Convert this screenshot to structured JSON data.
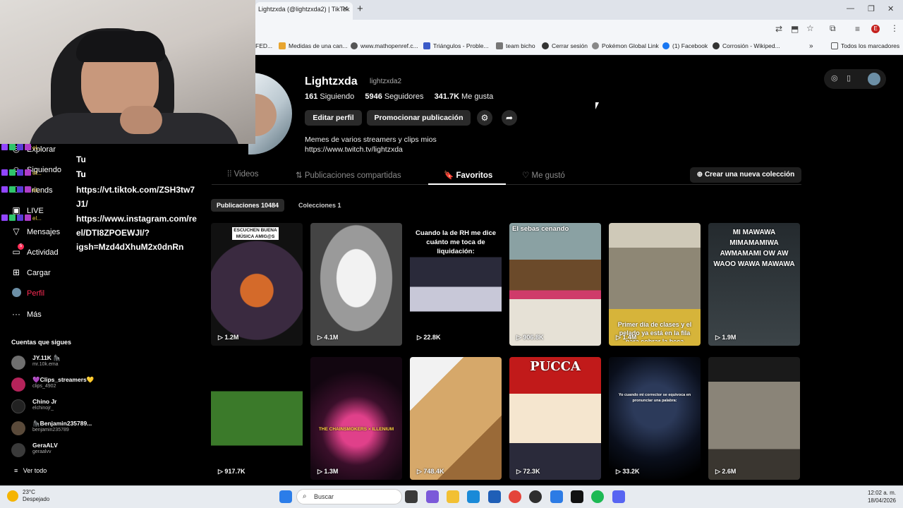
{
  "browser": {
    "tab_title": "Lightzxda (@lightzxda2) | TikTok",
    "new_tab": "+",
    "bookmarks": [
      "FED...",
      "Medidas de una can...",
      "www.mathopenref.c...",
      "Triángulos - Proble...",
      "team bicho",
      "Cerrar sesión",
      "Pokémon Global Link",
      "(1) Facebook",
      "Corrosión - Wikiped..."
    ],
    "all_bookmarks": "Todos los marcadores",
    "profile_initial": "E"
  },
  "sidebar": {
    "items": [
      {
        "label": "Explorar",
        "icon": "compass-icon"
      },
      {
        "label": "Siguiendo",
        "icon": "following-icon"
      },
      {
        "label": "Friends",
        "icon": "friends-icon"
      },
      {
        "label": "LIVE",
        "icon": "live-icon"
      },
      {
        "label": "Mensajes",
        "icon": "send-icon"
      },
      {
        "label": "Actividad",
        "icon": "bell-icon"
      },
      {
        "label": "Cargar",
        "icon": "plus-square-icon"
      },
      {
        "label": "Perfil",
        "icon": "profile-icon"
      },
      {
        "label": "Más",
        "icon": "more-icon"
      }
    ],
    "activity_badge": "5",
    "following_heading": "Cuentas que sigues",
    "accounts": [
      {
        "name": "JY.11K 🦍",
        "handle": "mr.10k.ema",
        "color": "#6f6f6f"
      },
      {
        "name": "💜Clips_streamers💛",
        "handle": "clips_4902",
        "color": "#b4235a"
      },
      {
        "name": "Chino Jr",
        "handle": "elchinojr_",
        "color": "#222222"
      },
      {
        "name": "🦍Benjamin235789...",
        "handle": "benjamin235789",
        "color": "#5a4a3a"
      },
      {
        "name": "GeraALV",
        "handle": "geraalvv",
        "color": "#3a3a3a"
      }
    ],
    "see_all": "Ver todo"
  },
  "chat": {
    "badge_user": "el...",
    "lines": [
      "Tu",
      "Tu",
      "Tu",
      "https://vt.tiktok.com/ZSH3tw7",
      "J1/",
      "https://www.instagram.com/re",
      "el/DTI8ZPOEWJI/?",
      "igsh=Mzd4dXhuM2x0dnRn"
    ]
  },
  "profile": {
    "name": "Lightzxda",
    "handle": "lightzxda2",
    "following_count": "161",
    "following_label": "Siguiendo",
    "followers_count": "5946",
    "followers_label": "Seguidores",
    "likes_count": "341.7K",
    "likes_label": "Me gusta",
    "edit_button": "Editar perfil",
    "promote_button": "Promocionar publicación",
    "bio_line1": "Memes de varios streamers y clips mios",
    "bio_link": "https://www.twitch.tv/lightzxda"
  },
  "tabs": [
    {
      "label": "Videos",
      "icon": "grid-icon"
    },
    {
      "label": "Publicaciones compartidas",
      "icon": "repost-icon"
    },
    {
      "label": "Favoritos",
      "icon": "bookmark-icon"
    },
    {
      "label": "Me gustó",
      "icon": "heart-outline-icon"
    }
  ],
  "active_tab": "Favoritos",
  "new_collection_button": "Crear una nueva colección",
  "subtabs": [
    {
      "label": "Publicaciones 10484"
    },
    {
      "label": "Colecciones 1"
    }
  ],
  "videos": [
    {
      "views": "1.2M",
      "caption": "ESCUCHEN BUENA MÚSICA AMIG@S",
      "bg": "#2a1a2c"
    },
    {
      "views": "4.1M",
      "caption": "",
      "bg": "#cfcfcf"
    },
    {
      "views": "22.8K",
      "caption": "Cuando la de RH me dice cuánto me toca de liquidación:",
      "bg": "#0a0a0a"
    },
    {
      "views": "906.8K",
      "caption": "El sebas cenando",
      "bg": "#7a8b8c"
    },
    {
      "views": "1.4M",
      "caption": "Primer día de clases y el pelado ya está en la fila para cobrar la beca",
      "bg": "#a89f86"
    },
    {
      "views": "1.9M",
      "caption": "MI MAWAWA MIMAMAMIWA AWMAMAMI OW AW WAOO WAWA MAWAWA",
      "bg": "#2c3236"
    },
    {
      "views": "917.7K",
      "caption": "",
      "bg": "#3b6a2a"
    },
    {
      "views": "1.3M",
      "caption": "THE CHAINSMOKERS × ILLENIUM",
      "bg": "#2a0f24"
    },
    {
      "views": "748.4K",
      "caption": "",
      "bg": "#c59a63"
    },
    {
      "views": "72.3K",
      "caption": "PUCCA",
      "bg": "#c11a1a"
    },
    {
      "views": "33.2K",
      "caption": "Yo cuando mi corrector se equivoca en pronunciar una palabra:",
      "bg": "#0c1424"
    },
    {
      "views": "2.6M",
      "caption": "",
      "bg": "#5b5650"
    }
  ],
  "taskbar": {
    "temperature": "23°C",
    "weather": "Despejado",
    "search_placeholder": "Buscar",
    "time": "12:02 a. m.",
    "date": "18/04/2026"
  }
}
